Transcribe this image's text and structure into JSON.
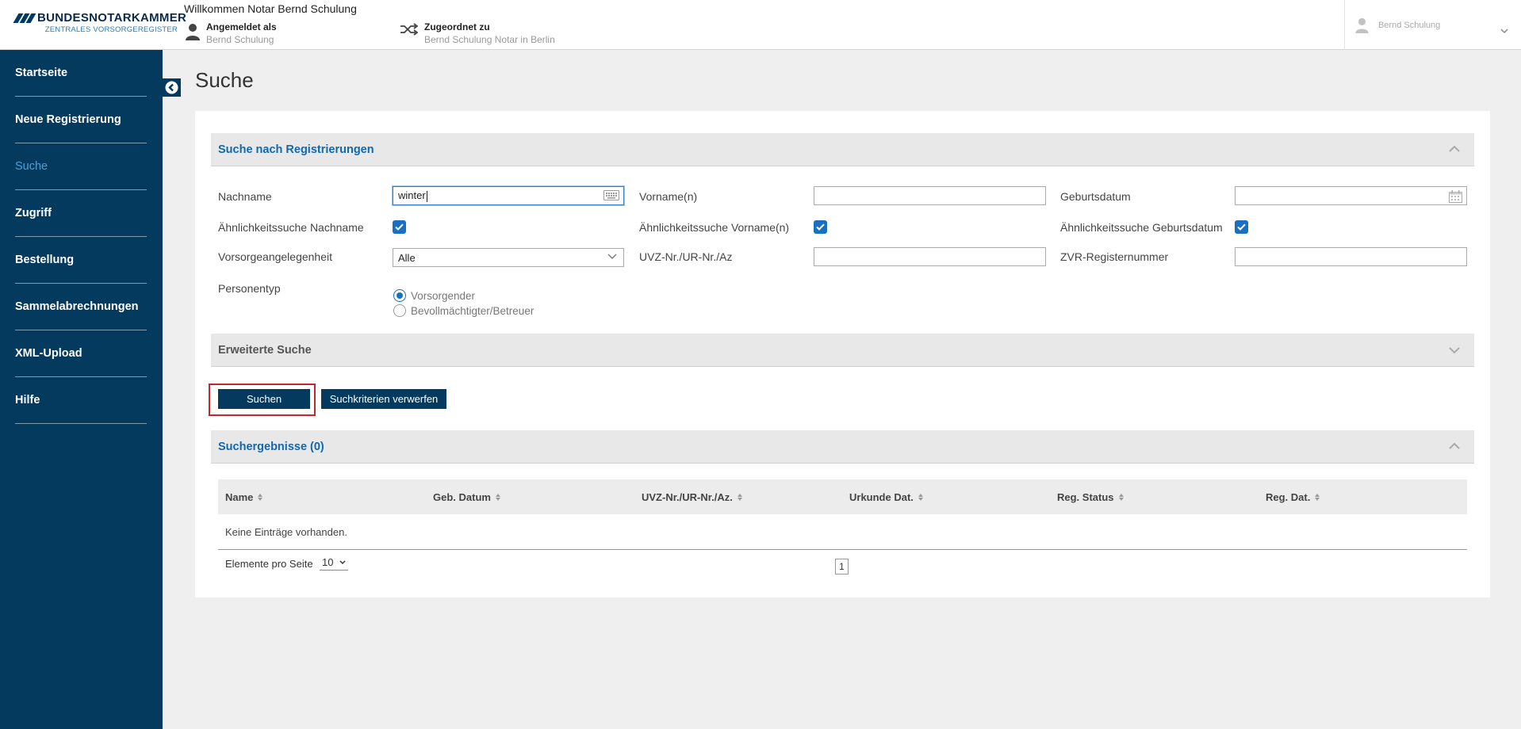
{
  "header": {
    "logo_title": "BUNDESNOTARKAMMER",
    "logo_subtitle": "ZENTRALES VORSORGEREGISTER",
    "welcome": "Willkommen Notar Bernd Schulung",
    "logged_in_label": "Angemeldet als",
    "logged_in_value": "Bernd Schulung",
    "assigned_label": "Zugeordnet zu",
    "assigned_value": "Bernd Schulung Notar in Berlin",
    "user_menu": "Bernd Schulung"
  },
  "sidebar": {
    "items": [
      {
        "label": "Startseite",
        "active": false
      },
      {
        "label": "Neue Registrierung",
        "active": false
      },
      {
        "label": "Suche",
        "active": true
      },
      {
        "label": "Zugriff",
        "active": false
      },
      {
        "label": "Bestellung",
        "active": false
      },
      {
        "label": "Sammelabrechnungen",
        "active": false
      },
      {
        "label": "XML-Upload",
        "active": false
      },
      {
        "label": "Hilfe",
        "active": false
      }
    ]
  },
  "page": {
    "title": "Suche"
  },
  "search_panel": {
    "title": "Suche nach Registrierungen",
    "fields": {
      "nachname_label": "Nachname",
      "nachname_value": "winter",
      "vorname_label": "Vorname(n)",
      "vorname_value": "",
      "geburtsdatum_label": "Geburtsdatum",
      "geburtsdatum_value": "",
      "aehnlich_nachname_label": "Ähnlichkeitssuche Nachname",
      "aehnlich_vorname_label": "Ähnlichkeitssuche Vorname(n)",
      "aehnlich_geburtsdatum_label": "Ähnlichkeitssuche Geburtsdatum",
      "vorsorge_label": "Vorsorgeangelegenheit",
      "vorsorge_value": "Alle",
      "uvz_label": "UVZ-Nr./UR-Nr./Az",
      "uvz_value": "",
      "zvr_label": "ZVR-Registernummer",
      "zvr_value": "",
      "personentyp_label": "Personentyp",
      "personentyp_options": [
        "Vorsorgender",
        "Bevollmächtigter/Betreuer"
      ],
      "personentyp_selected": "Vorsorgender"
    }
  },
  "advanced_panel": {
    "title": "Erweiterte Suche"
  },
  "buttons": {
    "search": "Suchen",
    "reset": "Suchkriterien verwerfen"
  },
  "results": {
    "title": "Suchergebnisse (0)",
    "columns": [
      "Name",
      "Geb. Datum",
      "UVZ-Nr./UR-Nr./Az.",
      "Urkunde Dat.",
      "Reg. Status",
      "Reg. Dat."
    ],
    "empty_text": "Keine Einträge vorhanden.",
    "per_page_label": "Elemente pro Seite",
    "per_page_value": "10",
    "current_page": "1"
  },
  "colors": {
    "sidebar_bg": "#043a5e",
    "accent_blue": "#1168b0",
    "focus_red": "#c1272d"
  }
}
